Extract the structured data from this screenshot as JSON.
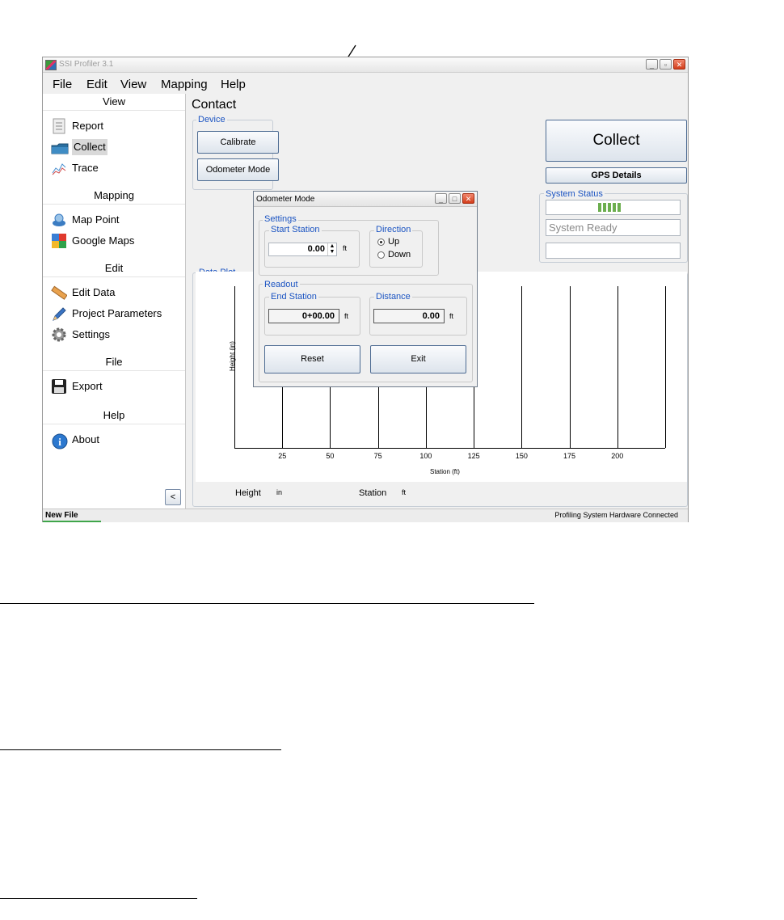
{
  "window": {
    "title": "SSI Profiler 3.1"
  },
  "menubar": [
    "File",
    "Edit",
    "View",
    "Mapping",
    "Help"
  ],
  "sidebar": {
    "sections": [
      {
        "title": "View",
        "items": [
          "Report",
          "Collect",
          "Trace"
        ]
      },
      {
        "title": "Mapping",
        "items": [
          "Map Point",
          "Google Maps"
        ]
      },
      {
        "title": "Edit",
        "items": [
          "Edit Data",
          "Project Parameters",
          "Settings"
        ]
      },
      {
        "title": "File",
        "items": [
          "Export"
        ]
      },
      {
        "title": "Help",
        "items": [
          "About"
        ]
      }
    ],
    "collapse_label": "<"
  },
  "main": {
    "heading": "Contact",
    "device": {
      "title": "Device",
      "calibrate": "Calibrate",
      "odometer": "Odometer Mode"
    },
    "collect_button": "Collect",
    "gps_details": "GPS Details",
    "system_status": {
      "title": "System Status",
      "status_text": "System Ready"
    },
    "data_plot": {
      "title": "Data Plot",
      "footer": {
        "height_label": "Height",
        "height_unit": "in",
        "station_label": "Station",
        "station_unit": "ft"
      }
    }
  },
  "chart_data": {
    "type": "line",
    "title": "",
    "xlabel": "Station (ft)",
    "ylabel": "Height (in)",
    "xticks": [
      25,
      50,
      75,
      100,
      125,
      150,
      175,
      200
    ],
    "xlim": [
      0,
      225
    ],
    "grid": true
  },
  "dialog": {
    "title": "Odometer Mode",
    "settings": {
      "title": "Settings",
      "start_station": {
        "title": "Start Station",
        "value": "0.00",
        "unit": "ft"
      },
      "direction": {
        "title": "Direction",
        "options": [
          "Up",
          "Down"
        ],
        "selected": "Up"
      }
    },
    "readout": {
      "title": "Readout",
      "end_station": {
        "title": "End Station",
        "value": "0+00.00",
        "unit": "ft"
      },
      "distance": {
        "title": "Distance",
        "value": "0.00",
        "unit": "ft"
      }
    },
    "reset": "Reset",
    "exit": "Exit"
  },
  "statusbar": {
    "left": "New File",
    "right": "Profiling System Hardware Connected"
  }
}
